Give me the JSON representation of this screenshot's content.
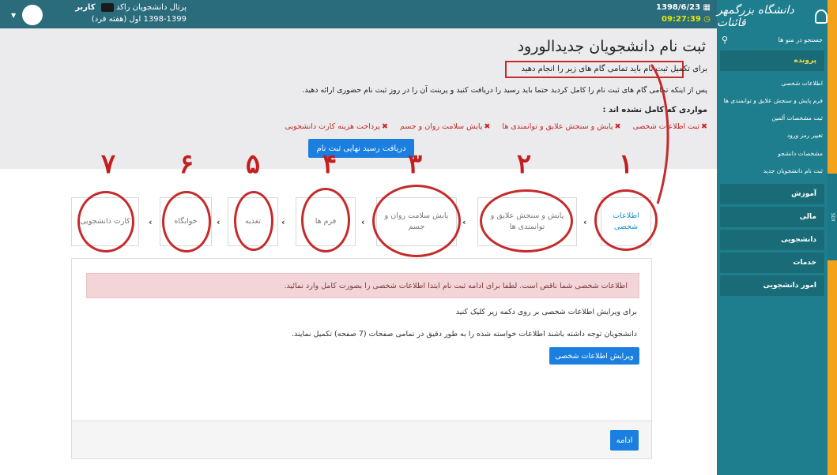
{
  "header": {
    "portal_label": "پرتال دانشجویان راکد",
    "user_prefix": "کاربر",
    "user_name": "‌‌‌‌‌‌‌‌‌‌‌‌",
    "term": "1398-1399 اول (هفته فرد)",
    "date": "1398/6/23",
    "time": "09:27:39"
  },
  "sidebar": {
    "logo": "دانشگاه بزرگمهر قائنات",
    "search_placeholder": "جستجو در منو ها",
    "active_menu": "پرونده",
    "submenu": [
      "اطلاعات شخصی",
      "فرم پایش و سنجش علایق و توانمندی ها",
      "ثبت مشخصات آلمین",
      "تغییر رمز ورود",
      "مشخصات دانشجو",
      "ثبت نام دانشجویان جدید"
    ],
    "menus": [
      "آموزش",
      "مالی",
      "دانشجویی",
      "خدمات",
      "امور دانشجویی"
    ],
    "edge_label": "SDI"
  },
  "page": {
    "title": "ثبت نام دانشجویان جدیدالورود",
    "description": "برای تکمیل ثبت نام باید تمامی گام های زیر را انجام دهید",
    "note": "پس از اینکه تمامی گام های ثبت نام را کامل کردید حتما باید رسید را دریافت کنید و پرینت آن را در روز ثبت نام حضوری ارائه دهید.",
    "incomplete_title": "مواردی که کامل نشده اند :",
    "incomplete_items": [
      "ثبت اطلاعات شخصی",
      "پایش و سنجش علایق و توانمندی ها",
      "پایش سلامت روان و جسم",
      "پرداخت هزینه کارت دانشجویی"
    ],
    "receipt_button": "دریافت رسید نهایی ثبت نام"
  },
  "steps": [
    {
      "number": "۱",
      "label": "اطلاعات شخصی",
      "active": true
    },
    {
      "number": "۲",
      "label": "پایش و سنجش علایق و توانمندی ها",
      "active": false
    },
    {
      "number": "۳",
      "label": "پایش سلامت روان و جسم",
      "active": false
    },
    {
      "number": "۴",
      "label": "فرم ها",
      "active": false
    },
    {
      "number": "۵",
      "label": "تغذیه",
      "active": false
    },
    {
      "number": "۶",
      "label": "خوابگاه",
      "active": false
    },
    {
      "number": "۷",
      "label": "کارت دانشجویی",
      "active": false
    }
  ],
  "panel": {
    "alert": "اطلاعات شخصی شما ناقص است. لطفا برای ادامه ثبت نام ابتدا اطلاعات شخصی را بصورت کامل وارد نمائید.",
    "edit_hint": "برای ویرایش اطلاعات شخصی بر روی دکمه زیر کلیک کنید",
    "edit_note": "دانشجویان توجه داشته باشند اطلاعات خواسته شده را به طور دقیق در تمامی صفحات (7 صفحه) تکمیل نمایند.",
    "edit_button": "ویرایش اطلاعات شخصی",
    "continue_button": "ادامه"
  },
  "colors": {
    "header": "#2a6b7c",
    "sidebar": "#1e7e8e",
    "primary_button": "#1b7fe0",
    "annotation_red": "#c42b2b",
    "alert_bg": "#f3d5d8",
    "edge_orange": "#f5a21b"
  }
}
